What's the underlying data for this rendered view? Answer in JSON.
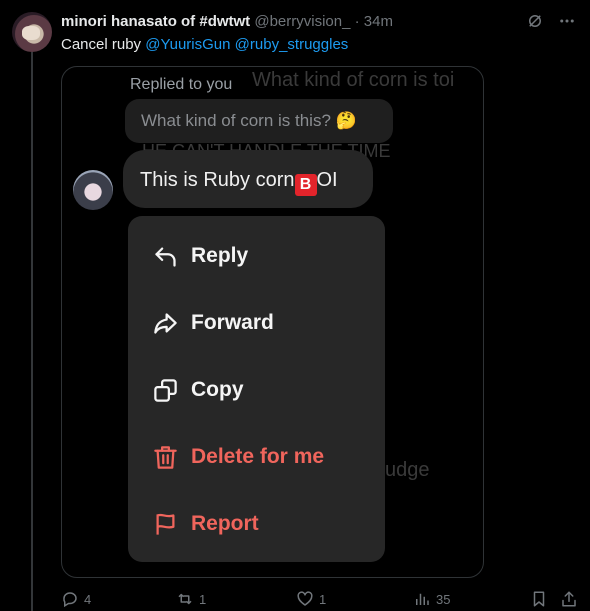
{
  "tweet": {
    "author_name": "minori hanasato of #dwtwt",
    "handle": "@berryvision_",
    "separator": "·",
    "time": "34m",
    "text_prefix": "Cancel ruby ",
    "mentions": [
      "@YuurisGun",
      "@ruby_struggles"
    ]
  },
  "dm": {
    "replied_to": "Replied to you",
    "quoted_text": "What kind of corn is this?",
    "quoted_emoji": "🤔",
    "message_text": "This is Ruby corn",
    "message_badge": "B",
    "message_suffix": "OI",
    "ghost_top": "What kind of corn is toi",
    "ghost_mid": "HE CAN'T HANDLE THE TIME",
    "ghost_bottom": "udge"
  },
  "context_menu": {
    "items": [
      {
        "label": "Reply",
        "icon": "reply-arrow-icon",
        "danger": false
      },
      {
        "label": "Forward",
        "icon": "forward-arrow-icon",
        "danger": false
      },
      {
        "label": "Copy",
        "icon": "copy-icon",
        "danger": false
      },
      {
        "label": "Delete for me",
        "icon": "trash-icon",
        "danger": true
      },
      {
        "label": "Report",
        "icon": "flag-icon",
        "danger": true
      }
    ]
  },
  "actions": {
    "replies": "4",
    "retweets": "1",
    "likes": "1",
    "views": "35"
  },
  "colors": {
    "background": "#000000",
    "mention": "#1d9bf0",
    "danger": "#f0655c",
    "menu_bg": "#272727",
    "badge_red": "#e3242b"
  }
}
